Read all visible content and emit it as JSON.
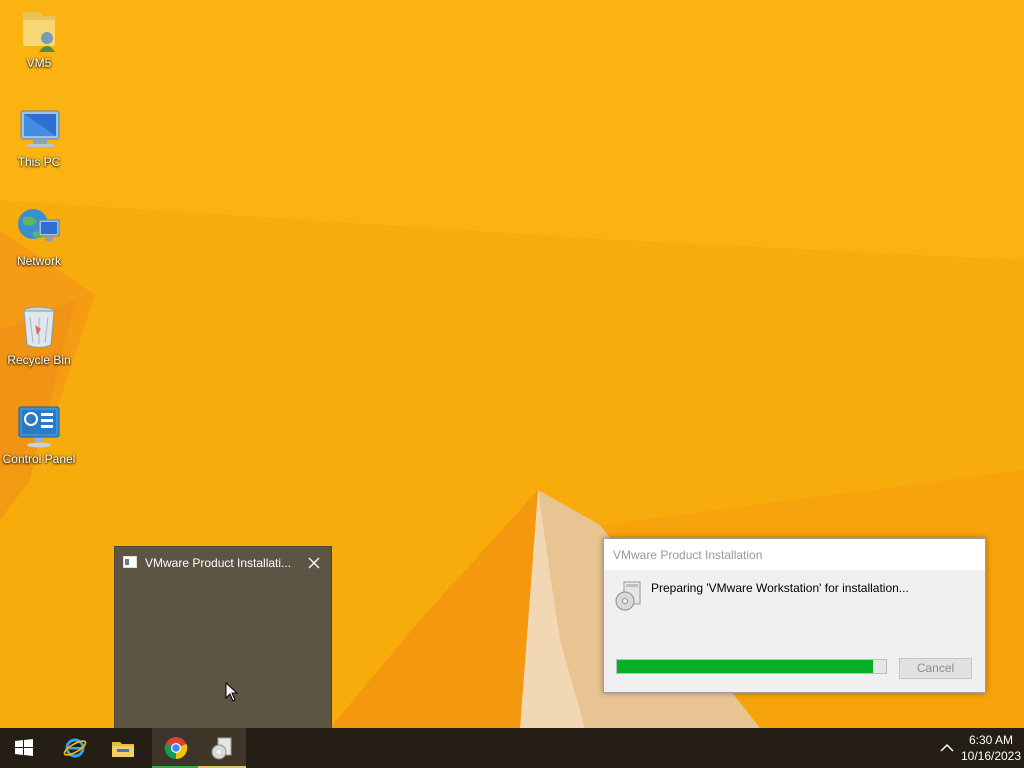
{
  "desktop": {
    "icons": [
      {
        "label": "VM5",
        "icon": "user-folder-icon"
      },
      {
        "label": "This PC",
        "icon": "computer-icon"
      },
      {
        "label": "Network",
        "icon": "network-icon"
      },
      {
        "label": "Recycle Bin",
        "icon": "recycle-bin-icon"
      },
      {
        "label": "Control Panel",
        "icon": "control-panel-icon"
      }
    ]
  },
  "thumbnail": {
    "title": "VMware Product Installati...",
    "close_icon": "close-icon"
  },
  "dialog": {
    "title": "VMware Product Installation",
    "message": "Preparing 'VMware Workstation' for installation...",
    "progress_percent": 95,
    "cancel_label": "Cancel",
    "progress_color": "#06b025"
  },
  "taskbar": {
    "buttons": [
      {
        "name": "start-button",
        "icon": "windows-logo-icon"
      },
      {
        "name": "internet-explorer-button",
        "icon": "internet-explorer-icon"
      },
      {
        "name": "file-explorer-button",
        "icon": "file-explorer-icon"
      },
      {
        "name": "chrome-button",
        "icon": "chrome-icon"
      },
      {
        "name": "vmware-installer-button",
        "icon": "installer-icon"
      }
    ],
    "time": "6:30 AM",
    "date": "10/16/2023"
  },
  "colors": {
    "wallpaper": "#f9ad0b",
    "taskbar": "#251e14",
    "chrome_active_line": "#37a84a",
    "installer_active_line": "#e0c073"
  }
}
